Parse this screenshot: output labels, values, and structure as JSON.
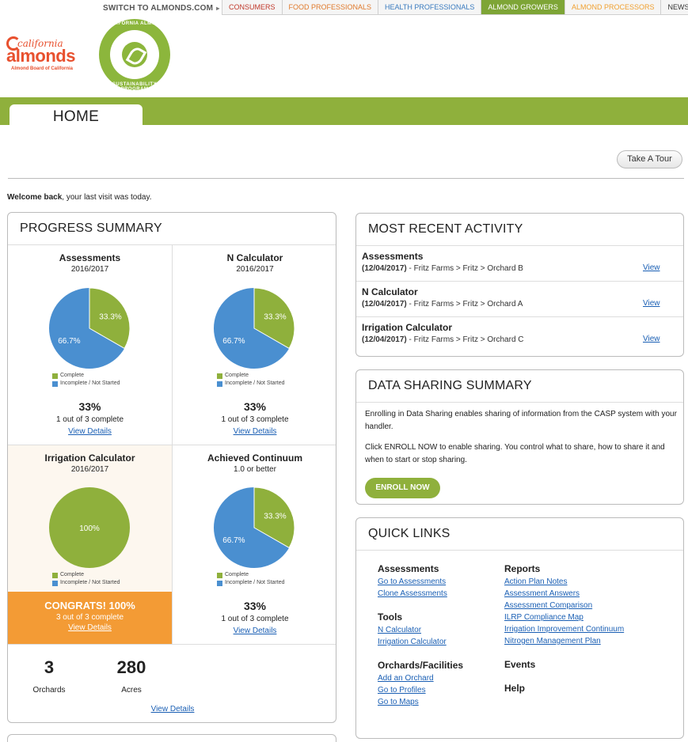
{
  "topnav": {
    "switch_label": "SWITCH TO ALMONDS.COM",
    "tabs": [
      {
        "label": "CONSUMERS",
        "color": "#c0392b",
        "bg": "#f5f5f5"
      },
      {
        "label": "FOOD PROFESSIONALS",
        "color": "#e07a2c",
        "bg": "#f5f5f5"
      },
      {
        "label": "HEALTH PROFESSIONALS",
        "color": "#3a7bbf",
        "bg": "#f5f5f5"
      },
      {
        "label": "ALMOND GROWERS",
        "color": "#ffffff",
        "bg": "#7ea536"
      },
      {
        "label": "ALMOND PROCESSORS",
        "color": "#f0a030",
        "bg": "#f5f5f5"
      },
      {
        "label": "NEWSROOM",
        "color": "#333333",
        "bg": "#f5f5f5"
      }
    ]
  },
  "logo": {
    "line1": "california",
    "line2": "almonds",
    "line3": "Almond Board of California"
  },
  "badge": {
    "top": "CALIFORNIA ALMOND",
    "bottom": "SUSTAINABILITY PROGRAM"
  },
  "header": {
    "home_tab": "HOME",
    "tour_button": "Take A Tour"
  },
  "welcome": {
    "bold": "Welcome back",
    "rest": ", your last visit was today."
  },
  "colors": {
    "green": "#8fb03c",
    "blue": "#4a8fd0",
    "orange": "#f39b35"
  },
  "progress": {
    "title": "PROGRESS SUMMARY",
    "legend_complete": "Complete",
    "legend_incomplete": "Incomplete / Not Started",
    "cells": [
      {
        "title": "Assessments",
        "subtitle": "2016/2017",
        "complete_pct": 33.3,
        "complete_label": "33.3%",
        "incomplete_label": "66.7%",
        "pct": "33%",
        "outof": "1 out of 3 complete",
        "link": "View Details"
      },
      {
        "title": "N Calculator",
        "subtitle": "2016/2017",
        "complete_pct": 33.3,
        "complete_label": "33.3%",
        "incomplete_label": "66.7%",
        "pct": "33%",
        "outof": "1 out of 3 complete",
        "link": "View Details"
      },
      {
        "title": "Irrigation Calculator",
        "subtitle": "2016/2017",
        "complete_pct": 100,
        "complete_label": "100%",
        "incomplete_label": "",
        "pct": "CONGRATS! 100%",
        "outof": "3 out of 3 complete",
        "link": "View Details"
      },
      {
        "title": "Achieved Continuum",
        "subtitle": "1.0 or better",
        "complete_pct": 33.3,
        "complete_label": "33.3%",
        "incomplete_label": "66.7%",
        "pct": "33%",
        "outof": "1 out of 3 complete",
        "link": "View Details"
      }
    ],
    "orchards_value": "3",
    "orchards_label": "Orchards",
    "acres_value": "280",
    "acres_label": "Acres",
    "footer_link": "View Details"
  },
  "activity": {
    "title": "MOST RECENT ACTIVITY",
    "rows": [
      {
        "title": "Assessments",
        "date": "(12/04/2017)",
        "path": " - Fritz Farms > Fritz > Orchard B",
        "link": "View"
      },
      {
        "title": "N Calculator",
        "date": "(12/04/2017)",
        "path": " - Fritz Farms > Fritz > Orchard A",
        "link": "View"
      },
      {
        "title": "Irrigation Calculator",
        "date": "(12/04/2017)",
        "path": " - Fritz Farms > Fritz > Orchard C",
        "link": "View"
      }
    ]
  },
  "datasharing": {
    "title": "DATA SHARING SUMMARY",
    "p1": "Enrolling in Data Sharing enables sharing of information from the CASP system with your handler.",
    "p2": "Click ENROLL NOW to enable sharing. You control what to share, how to share it and when to start or stop sharing.",
    "button": "ENROLL NOW"
  },
  "quicklinks": {
    "title": "QUICK LINKS",
    "assessments": {
      "heading": "Assessments",
      "links": [
        "Go to Assessments",
        "Clone Assessments"
      ]
    },
    "tools": {
      "heading": "Tools",
      "links": [
        "N Calculator",
        "Irrigation Calculator"
      ]
    },
    "orchards": {
      "heading": "Orchards/Facilities",
      "links": [
        "Add an Orchard",
        "Go to Profiles",
        "Go to Maps"
      ]
    },
    "reports": {
      "heading": "Reports",
      "links": [
        "Action Plan Notes",
        "Assessment Answers",
        "Assessment Comparison",
        "ILRP Compliance Map",
        "Irrigation Improvement Continuum",
        "Nitrogen Management Plan"
      ]
    },
    "events": "Events",
    "help": "Help"
  }
}
